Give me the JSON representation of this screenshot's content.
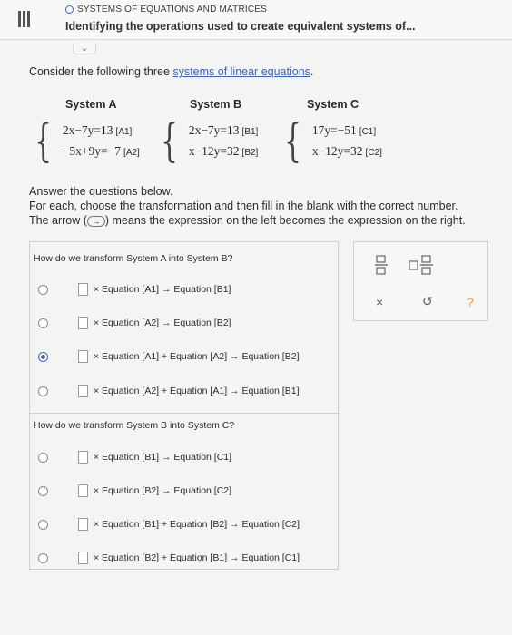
{
  "header": {
    "topic": "SYSTEMS OF EQUATIONS AND MATRICES",
    "title": "Identifying the operations used to create equivalent systems of..."
  },
  "intro": {
    "prefix": "Consider the following three ",
    "link": "systems of linear equations",
    "suffix": "."
  },
  "systems": [
    {
      "name": "System A",
      "eqs": [
        {
          "expr": "2x−7y=13",
          "label": "[A1]"
        },
        {
          "expr": "−5x+9y=−7",
          "label": "[A2]"
        }
      ]
    },
    {
      "name": "System B",
      "eqs": [
        {
          "expr": "2x−7y=13",
          "label": "[B1]"
        },
        {
          "expr": "x−12y=32",
          "label": "[B2]"
        }
      ]
    },
    {
      "name": "System C",
      "eqs": [
        {
          "expr": "17y=−51",
          "label": "[C1]"
        },
        {
          "expr": "x−12y=32",
          "label": "[C2]"
        }
      ]
    }
  ],
  "answer": {
    "line1": "Answer the questions below.",
    "line2": "For each, choose the transformation and then fill in the blank with the correct number.",
    "line3_pre": "The arrow (",
    "arrow": "→",
    "line3_post": ") means the expression on the left becomes the expression on the right."
  },
  "question1": {
    "prompt": "How do we transform System A into System B?",
    "options": [
      {
        "text": "× Equation [A1] → Equation [B1]",
        "selected": false
      },
      {
        "text": "× Equation [A2] → Equation [B2]",
        "selected": false
      },
      {
        "text": "× Equation [A1] + Equation [A2] → Equation [B2]",
        "selected": true
      },
      {
        "text": "× Equation [A2] + Equation [A1] → Equation [B1]",
        "selected": false
      }
    ]
  },
  "question2": {
    "prompt": "How do we transform System B into System C?",
    "options": [
      {
        "text": "× Equation [B1] → Equation [C1]",
        "selected": false
      },
      {
        "text": "× Equation [B2] → Equation [C2]",
        "selected": false
      },
      {
        "text": "× Equation [B1] + Equation [B2] → Equation [C2]",
        "selected": false
      },
      {
        "text": "× Equation [B2] + Equation [B1] → Equation [C1]",
        "selected": false
      }
    ]
  },
  "tools": {
    "clear": "×",
    "undo": "↺",
    "help": "?"
  },
  "colors": {
    "accent": "#3d64b8",
    "help": "#e0a020"
  }
}
